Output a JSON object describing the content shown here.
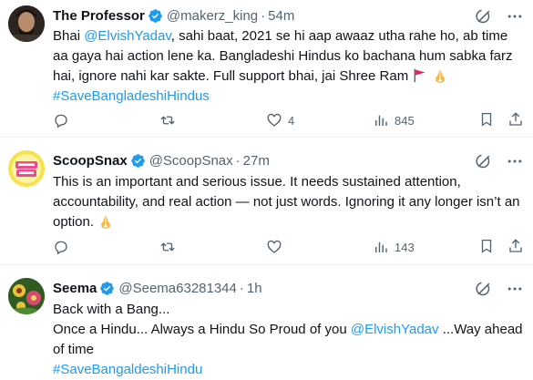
{
  "tweets": [
    {
      "name": "The Professor",
      "handle": "@makerz_king",
      "dot": "·",
      "time": "54m",
      "body": [
        {
          "t": "Bhai "
        },
        {
          "t": "@ElvishYadav",
          "link": true
        },
        {
          "t": ", sahi baat, 2021 se hi aap awaaz utha rahe ho, ab time aa gaya hai action lene ka. Bangladeshi Hindus ko bachana hum sabka farz hai, ignore nahi kar sakte. Full support bhai, jai Shree Ram "
        }
      ],
      "hashtag": "#SaveBangladeshiHindus",
      "emoji": [
        "red-flag",
        "folded-hands"
      ],
      "stats": {
        "replies": "",
        "reposts": "",
        "likes": "4",
        "views": "845"
      },
      "avatar_colors": [
        "#3a2a22",
        "#c49a7a"
      ]
    },
    {
      "name": "ScoopSnax",
      "handle": "@ScoopSnax",
      "dot": "·",
      "time": "27m",
      "body": [
        {
          "t": "This is an important and serious issue. It needs sustained attention, accountability, and real action — not just words. Ignoring it any longer isn’t an option. "
        }
      ],
      "emoji": [
        "folded-hands"
      ],
      "stats": {
        "replies": "",
        "reposts": "",
        "likes": "",
        "views": "143"
      },
      "avatar_colors": [
        "#f7e24a",
        "#e94e8a"
      ]
    },
    {
      "name": "Seema",
      "handle": "@Seema63281344",
      "dot": "·",
      "time": "1h",
      "body": [
        {
          "t": "Back with a Bang..."
        },
        {
          "br": true
        },
        {
          "t": "Once a Hindu... Always a Hindu  So Proud of you "
        },
        {
          "t": "@ElvishYadav",
          "link": true
        },
        {
          "t": " ...Way ahead of time"
        }
      ],
      "hashtag": "#SaveBangaldeshiHindu",
      "emoji": [],
      "avatar_colors": [
        "#3f6b2a",
        "#e7c23a"
      ]
    }
  ],
  "colors": {
    "accent": "#1d9bf0",
    "muted": "#536471",
    "text": "#0f1419",
    "verified": "#1d9bf0"
  },
  "icons": [
    "verified-badge-icon",
    "grok-icon",
    "more-icon",
    "reply-icon",
    "repost-icon",
    "like-icon",
    "views-icon",
    "bookmark-icon",
    "share-icon"
  ]
}
